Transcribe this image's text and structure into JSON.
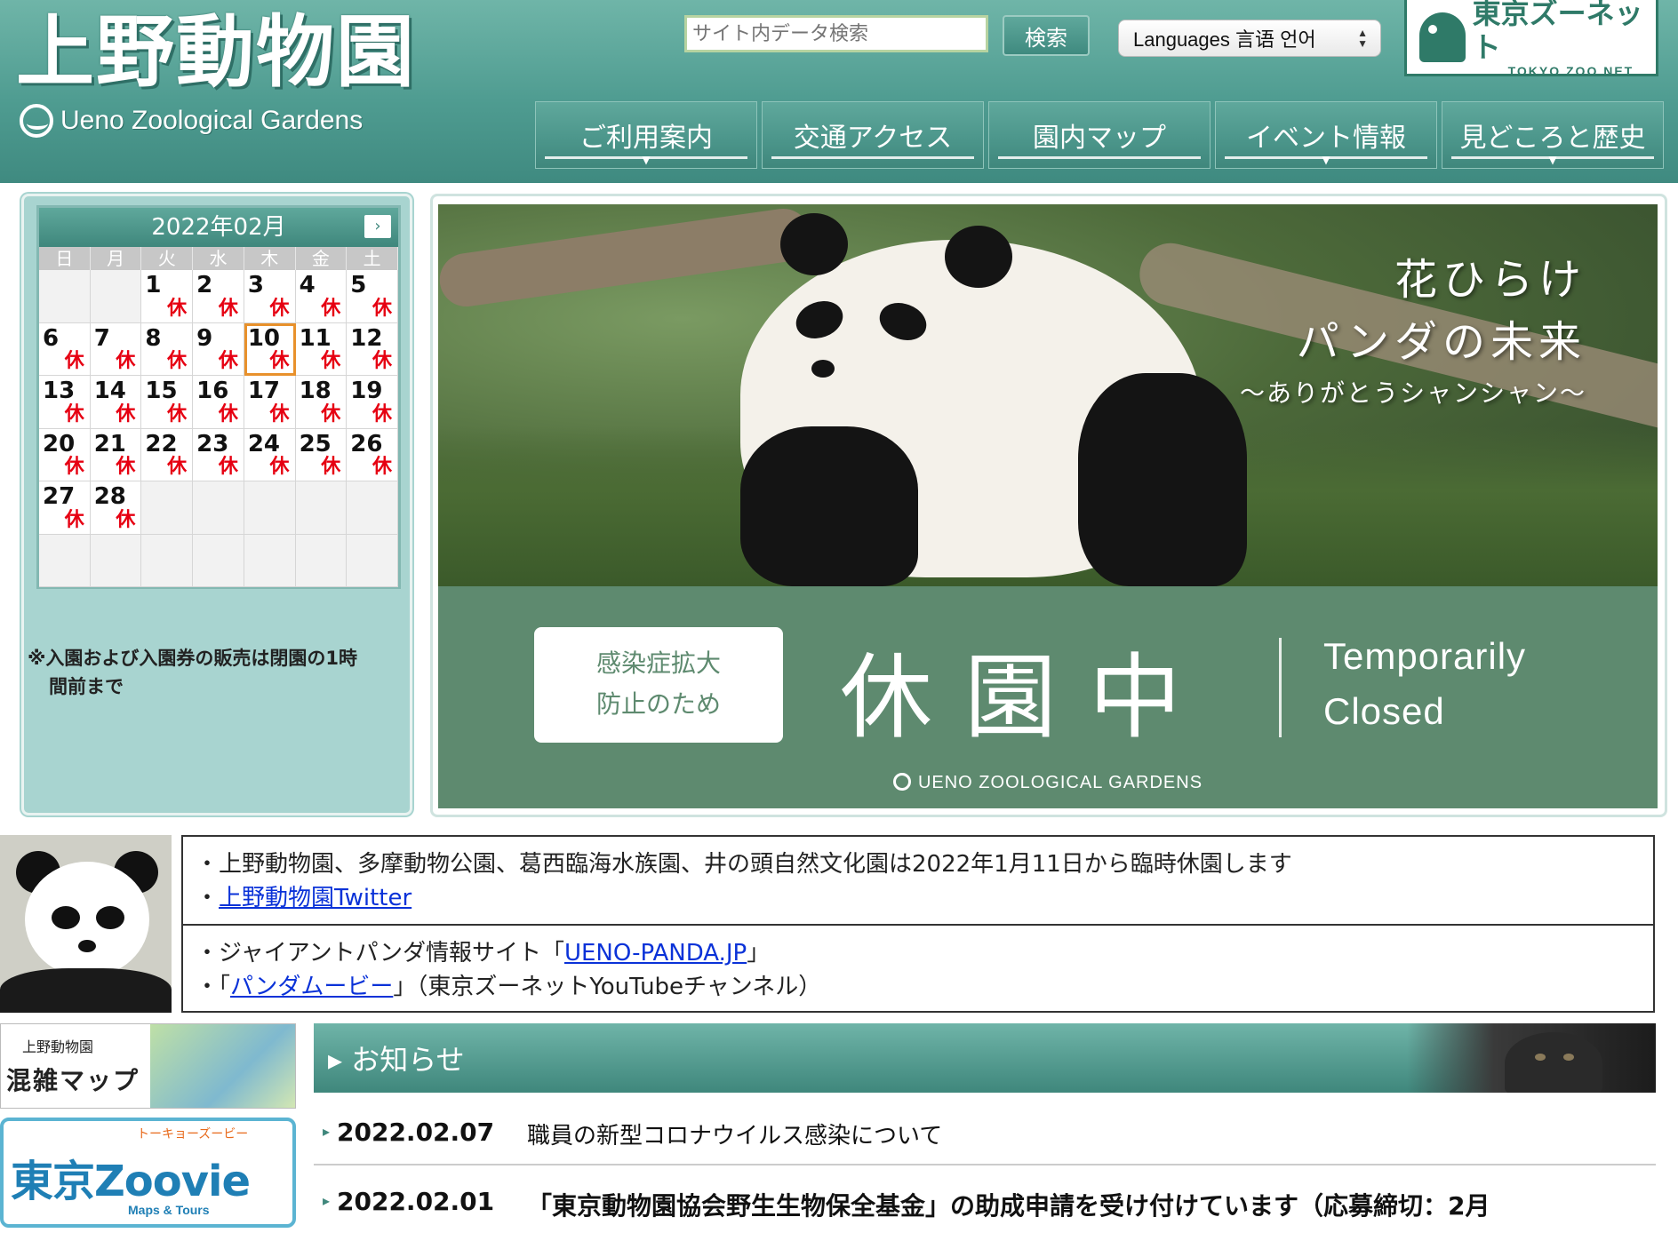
{
  "header": {
    "logo_jp": "上野動物園",
    "logo_en": "Ueno Zoological Gardens",
    "search_placeholder": "サイト内データ検索",
    "search_button": "検索",
    "language_label": "Languages 言语 언어",
    "zoonet_title": "東京ズーネット",
    "zoonet_subtitle": "TOKYO ZOO NET"
  },
  "nav": {
    "items": [
      {
        "label": "ご利用案内",
        "has_dropdown": true
      },
      {
        "label": "交通アクセス",
        "has_dropdown": false
      },
      {
        "label": "園内マップ",
        "has_dropdown": false
      },
      {
        "label": "イベント情報",
        "has_dropdown": true
      },
      {
        "label": "見どころと歴史",
        "has_dropdown": true
      }
    ]
  },
  "calendar": {
    "month_label": "2022年02月",
    "next_arrow": "›",
    "weekdays": [
      "日",
      "月",
      "火",
      "水",
      "木",
      "金",
      "土"
    ],
    "closed_mark": "休",
    "today": 10,
    "first_weekday_index": 2,
    "days_in_month": 28,
    "closed_days": [
      1,
      2,
      3,
      4,
      5,
      6,
      7,
      8,
      9,
      10,
      11,
      12,
      13,
      14,
      15,
      16,
      17,
      18,
      19,
      20,
      21,
      22,
      23,
      24,
      25,
      26,
      27,
      28
    ],
    "note_line1": "※入園および入園券の販売は閉園の1時",
    "note_line2": "間前まで"
  },
  "hero": {
    "title_line1": "花ひらけ",
    "title_line2": "パンダの未来",
    "title_line3": "～ありがとうシャンシャン～",
    "box_line1": "感染症拡大",
    "box_line2": "防止のため",
    "closed_big": "休園中",
    "closed_en_line1": "Temporarily",
    "closed_en_line2": "Closed",
    "footer": "UENO ZOOLOGICAL GARDENS"
  },
  "notices": {
    "row1_text": "・上野動物園、多摩動物公園、葛西臨海水族園、井の頭自然文化園は2022年1月11日から臨時休園します",
    "row1_link_prefix": "・",
    "row1_link": "上野動物園Twitter",
    "row2_prefix": "・ジャイアントパンダ情報サイト「",
    "row2_link": "UENO-PANDA.JP",
    "row2_suffix": "」",
    "row3_prefix": "・「",
    "row3_link": "パンダムービー",
    "row3_suffix": "」（東京ズーネットYouTubeチャンネル）"
  },
  "sidebar_banners": {
    "congestion_small": "上野動物園",
    "congestion_title": "混雑マップ",
    "zoovie_ruby": "トーキョーズービー",
    "zoovie_title": "東京Zoovie",
    "zoovie_sub": "Maps & Tours"
  },
  "news": {
    "heading": "お知らせ",
    "items": [
      {
        "date": "2022.02.07",
        "title": "職員の新型コロナウイルス感染について"
      },
      {
        "date": "2022.02.01",
        "title": "「東京動物園協会野生生物保全基金」の助成申請を受け付けています（応募締切：2月"
      }
    ]
  }
}
